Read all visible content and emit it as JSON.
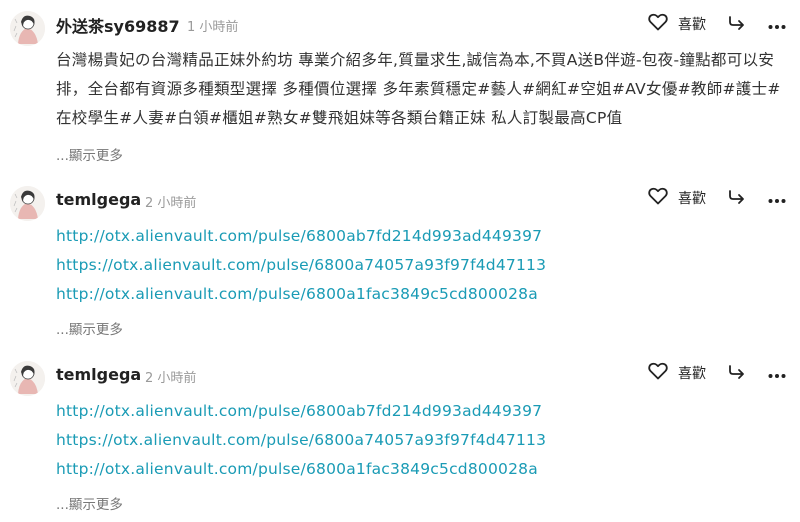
{
  "comments": [
    {
      "author": "外送茶sy69887",
      "time": "1 小時前",
      "like_label": "喜歡",
      "text": "台灣楊貴妃の台灣精品正妹外約坊 專業介紹多年,質量求生,誠信為本,不買A送B伴遊-包夜-鐘點都可以安排，全台都有資源多種類型選擇 多種價位選擇 多年素質穩定#藝人#網紅#空姐#AV女優#教師#護士#在校學生#人妻#白領#櫃姐#熟女#雙飛姐妹等各類台籍正妹 私人訂製最高CP值",
      "show_more": "...顯示更多"
    },
    {
      "author": "temlgega",
      "time": "2 小時前",
      "like_label": "喜歡",
      "links": [
        "http://otx.alienvault.com/pulse/6800ab7fd214d993ad449397",
        "https://otx.alienvault.com/pulse/6800a74057a93f97f4d47113",
        "http://otx.alienvault.com/pulse/6800a1fac3849c5cd800028a"
      ],
      "show_more": "...顯示更多"
    },
    {
      "author": "temlgega",
      "time": "2 小時前",
      "like_label": "喜歡",
      "links": [
        "http://otx.alienvault.com/pulse/6800ab7fd214d993ad449397",
        "https://otx.alienvault.com/pulse/6800a74057a93f97f4d47113",
        "http://otx.alienvault.com/pulse/6800a1fac3849c5cd800028a"
      ],
      "show_more": "...顯示更多"
    }
  ],
  "colors": {
    "link": "#1a9bb5",
    "muted": "#9a9a9a",
    "text": "#333333"
  },
  "icons": {
    "like": "heart-outline-icon",
    "share": "share-arrow-icon",
    "more": "more-dots-icon",
    "avatar": "illustrated-avatar"
  }
}
